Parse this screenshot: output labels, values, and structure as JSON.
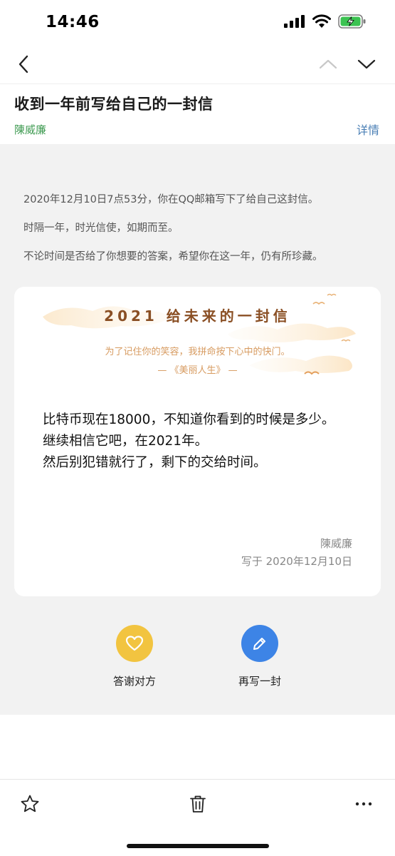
{
  "status_bar": {
    "time": "14:46"
  },
  "email": {
    "subject": "收到一年前写给自己的一封信",
    "sender": "陳威廉",
    "details_label": "详情"
  },
  "intro_lines": [
    "2020年12月10日7点53分，你在QQ邮箱写下了给自己这封信。",
    "时隔一年，时光信使，如期而至。",
    "不论时间是否给了你想要的答案，希望你在这一年，仍有所珍藏。"
  ],
  "letter": {
    "title": "2021 给未来的一封信",
    "quote": "为了记住你的笑容，我拼命按下心中的快门。",
    "quote_source": "— 《美丽人生》 —",
    "body": [
      "比特币现在18000，不知道你看到的时候是多少。",
      "继续相信它吧，在2021年。",
      "然后别犯错就行了，剩下的交给时间。"
    ],
    "signature": "陳威廉",
    "written_date": "写于 2020年12月10日"
  },
  "actions": {
    "thank_label": "答谢对方",
    "write_again_label": "再写一封"
  },
  "colors": {
    "sender_green": "#3f9b52",
    "link_blue": "#4a7fb5",
    "thank_yellow": "#f2c440",
    "write_blue": "#3d84e6",
    "title_brown": "#8a4f24",
    "quote_orange": "#d79b60"
  },
  "icons": [
    "back-arrow-icon",
    "chevron-up-icon",
    "chevron-down-icon",
    "heart-icon",
    "pencil-icon",
    "star-icon",
    "trash-icon",
    "more-icon"
  ]
}
